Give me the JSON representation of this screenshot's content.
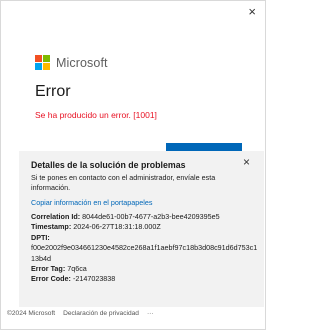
{
  "window": {
    "close_glyph": "×"
  },
  "brand": {
    "name": "Microsoft",
    "logo_colors": [
      "#f25022",
      "#7fba00",
      "#00a4ef",
      "#ffb900"
    ]
  },
  "error": {
    "title": "Error",
    "message": "Se ha producido un error. [1001]",
    "message_color": "#e81123"
  },
  "accent_color": "#0067b8",
  "details_panel": {
    "close_glyph": "×",
    "title": "Detalles de la solución de problemas",
    "description": "Si te pones en contacto con el administrador, envíale esta información.",
    "copy_link": "Copiar información en el portapapeles",
    "correlation_label": "Correlation Id:",
    "correlation_value": "8044de61-00b7-4677-a2b3-bee4209395e5",
    "timestamp_label": "Timestamp:",
    "timestamp_value": "2024-06-27T18:31:18.000Z",
    "dpti_label": "DPTI:",
    "dpti_value": "f00e2002f9e034661230e4582ce268a1f1aebf97c18b3d08c91d6d753c113b4d",
    "error_tag_label": "Error Tag:",
    "error_tag_value": "7q6ca",
    "error_code_label": "Error Code:",
    "error_code_value": "-2147023838"
  },
  "footer": {
    "copyright": "©2024 Microsoft",
    "privacy": "Declaración de privacidad",
    "more": "···"
  }
}
